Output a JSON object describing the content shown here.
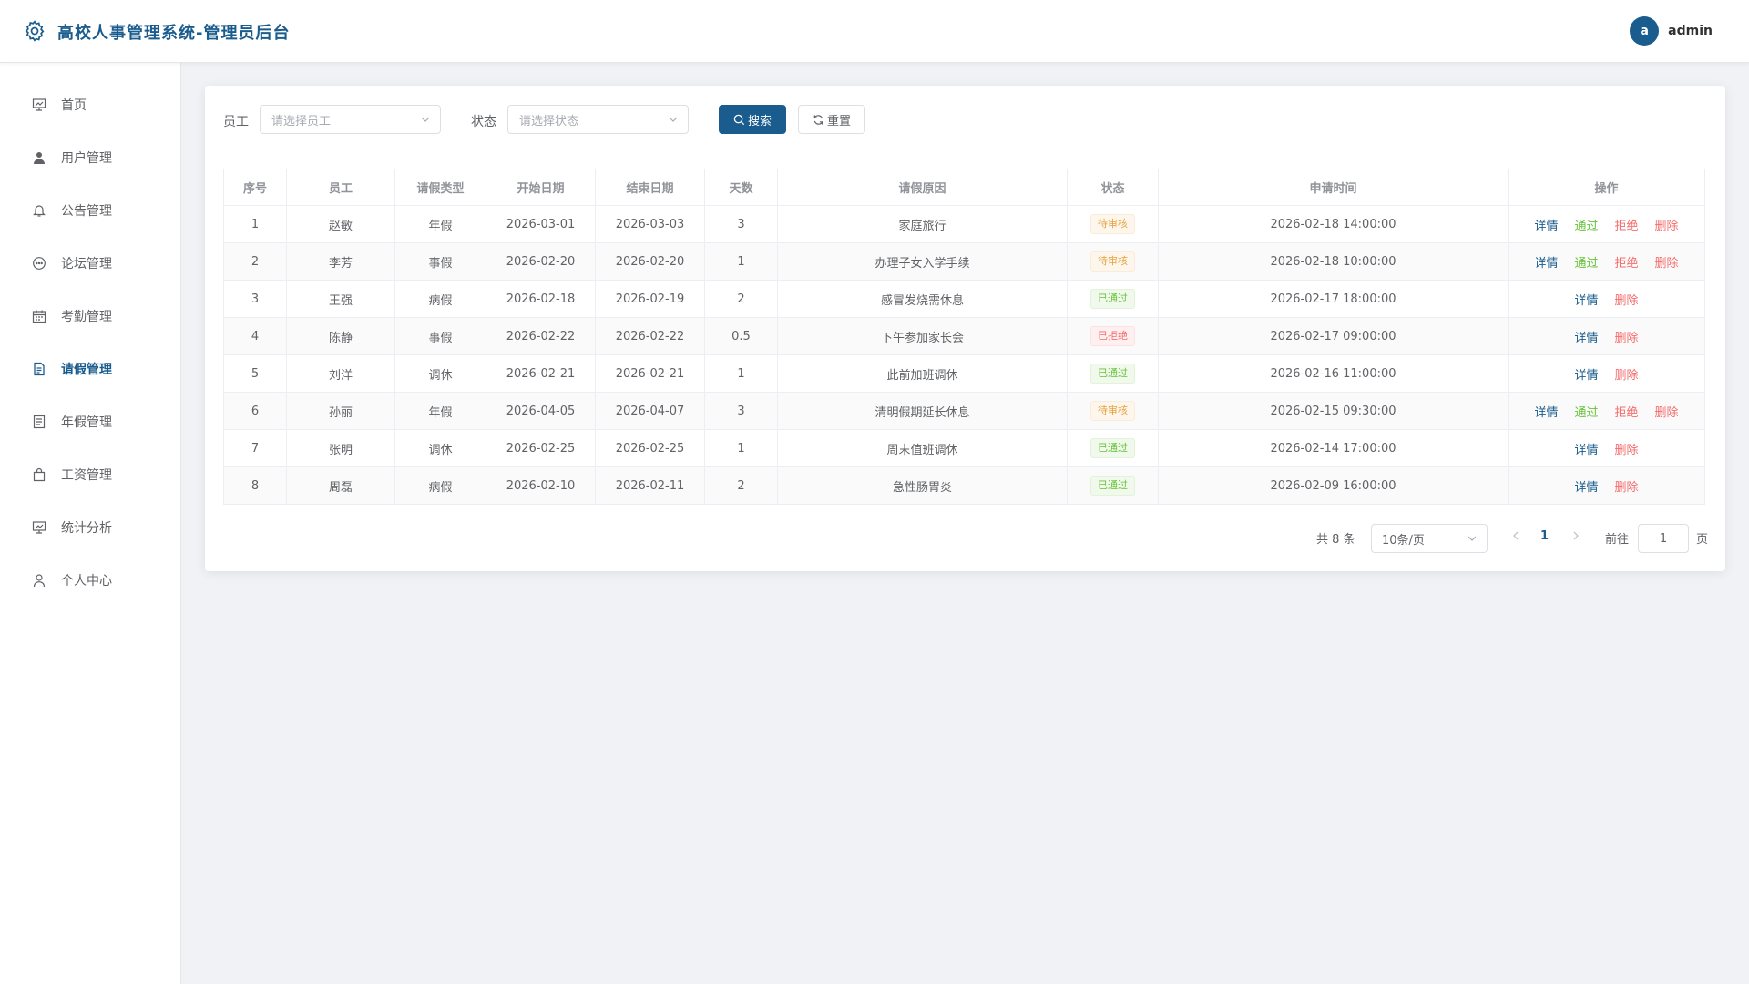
{
  "app": {
    "title": "高校人事管理系统-管理员后台"
  },
  "user": {
    "avatar_letter": "a",
    "name": "admin"
  },
  "sidebar": {
    "items": [
      {
        "label": "首页",
        "icon": "dashboard-icon"
      },
      {
        "label": "用户管理",
        "icon": "user-icon"
      },
      {
        "label": "公告管理",
        "icon": "bell-icon"
      },
      {
        "label": "论坛管理",
        "icon": "chat-icon"
      },
      {
        "label": "考勤管理",
        "icon": "calendar-icon"
      },
      {
        "label": "请假管理",
        "icon": "document-icon"
      },
      {
        "label": "年假管理",
        "icon": "list-icon"
      },
      {
        "label": "工资管理",
        "icon": "bag-icon"
      },
      {
        "label": "统计分析",
        "icon": "chart-icon"
      },
      {
        "label": "个人中心",
        "icon": "profile-icon"
      }
    ],
    "active_index": 5
  },
  "filters": {
    "employee_label": "员工",
    "employee_placeholder": "请选择员工",
    "status_label": "状态",
    "status_placeholder": "请选择状态",
    "search_label": "搜索",
    "reset_label": "重置"
  },
  "table": {
    "columns": [
      "序号",
      "员工",
      "请假类型",
      "开始日期",
      "结束日期",
      "天数",
      "请假原因",
      "状态",
      "申请时间",
      "操作"
    ],
    "rows": [
      {
        "no": "1",
        "employee": "赵敏",
        "type": "年假",
        "start": "2026-03-01",
        "end": "2026-03-03",
        "days": "3",
        "reason": "家庭旅行",
        "status": "待审核",
        "status_kind": "pending",
        "applied": "2026-02-18 14:00:00"
      },
      {
        "no": "2",
        "employee": "李芳",
        "type": "事假",
        "start": "2026-02-20",
        "end": "2026-02-20",
        "days": "1",
        "reason": "办理子女入学手续",
        "status": "待审核",
        "status_kind": "pending",
        "applied": "2026-02-18 10:00:00"
      },
      {
        "no": "3",
        "employee": "王强",
        "type": "病假",
        "start": "2026-02-18",
        "end": "2026-02-19",
        "days": "2",
        "reason": "感冒发烧需休息",
        "status": "已通过",
        "status_kind": "approved",
        "applied": "2026-02-17 18:00:00"
      },
      {
        "no": "4",
        "employee": "陈静",
        "type": "事假",
        "start": "2026-02-22",
        "end": "2026-02-22",
        "days": "0.5",
        "reason": "下午参加家长会",
        "status": "已拒绝",
        "status_kind": "rejected",
        "applied": "2026-02-17 09:00:00"
      },
      {
        "no": "5",
        "employee": "刘洋",
        "type": "调休",
        "start": "2026-02-21",
        "end": "2026-02-21",
        "days": "1",
        "reason": "此前加班调休",
        "status": "已通过",
        "status_kind": "approved",
        "applied": "2026-02-16 11:00:00"
      },
      {
        "no": "6",
        "employee": "孙丽",
        "type": "年假",
        "start": "2026-04-05",
        "end": "2026-04-07",
        "days": "3",
        "reason": "清明假期延长休息",
        "status": "待审核",
        "status_kind": "pending",
        "applied": "2026-02-15 09:30:00"
      },
      {
        "no": "7",
        "employee": "张明",
        "type": "调休",
        "start": "2026-02-25",
        "end": "2026-02-25",
        "days": "1",
        "reason": "周末值班调休",
        "status": "已通过",
        "status_kind": "approved",
        "applied": "2026-02-14 17:00:00"
      },
      {
        "no": "8",
        "employee": "周磊",
        "type": "病假",
        "start": "2026-02-10",
        "end": "2026-02-11",
        "days": "2",
        "reason": "急性肠胃炎",
        "status": "已通过",
        "status_kind": "approved",
        "applied": "2026-02-09 16:00:00"
      }
    ],
    "actions": {
      "detail": "详情",
      "approve": "通过",
      "reject": "拒绝",
      "delete": "删除"
    }
  },
  "pagination": {
    "total_text": "共 8 条",
    "page_size": "10条/页",
    "current_page": "1",
    "goto_label": "前往",
    "goto_value": "1",
    "goto_unit": "页"
  },
  "colors": {
    "brand": "#1a5c8e",
    "pending": "#e6a23c",
    "approved": "#67c23a",
    "rejected": "#f56c6c"
  }
}
